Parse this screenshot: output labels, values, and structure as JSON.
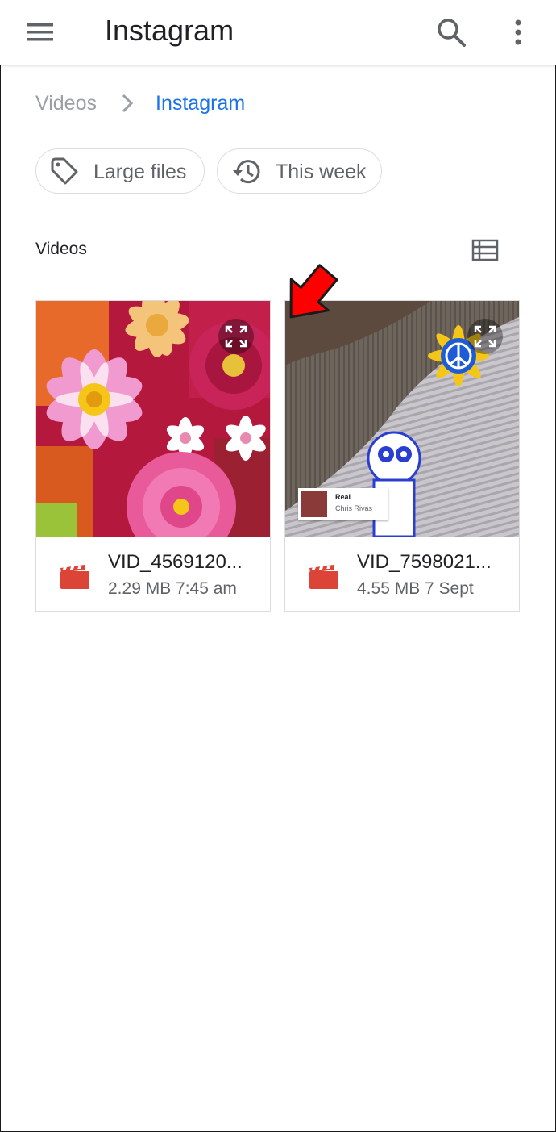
{
  "appbar": {
    "title": "Instagram",
    "menu_icon": "menu-icon",
    "search_icon": "search-icon",
    "more_icon": "more-vert-icon"
  },
  "breadcrumb": {
    "parent": "Videos",
    "current": "Instagram"
  },
  "filters": [
    {
      "label": "Large files",
      "icon": "tag-icon"
    },
    {
      "label": "This week",
      "icon": "history-icon"
    }
  ],
  "section": {
    "title": "Videos",
    "view_toggle_icon": "list-view-icon"
  },
  "files": [
    {
      "name": "VID_4569120...",
      "meta": "2.29 MB 7:45 am",
      "thumbnail": "flowers"
    },
    {
      "name": "VID_7598021...",
      "meta": "4.55 MB 7 Sept",
      "thumbnail": "cartoon-on-carpet",
      "music_sticker": {
        "title": "Real",
        "artist": "Chris Rivas"
      }
    }
  ],
  "colors": {
    "accent": "#1a73e8",
    "video_icon": "#db4437",
    "annotation_arrow": "#ff0000"
  }
}
